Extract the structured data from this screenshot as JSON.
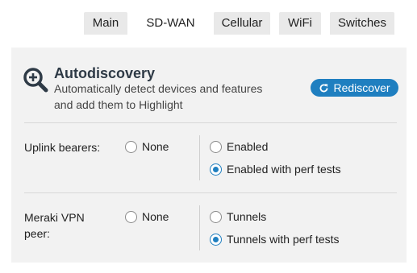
{
  "tabs": [
    {
      "label": "Main",
      "active": false
    },
    {
      "label": "SD-WAN",
      "active": true
    },
    {
      "label": "Cellular",
      "active": false
    },
    {
      "label": "WiFi",
      "active": false
    },
    {
      "label": "Switches",
      "active": false
    }
  ],
  "autodiscovery": {
    "icon": "magnifier-plus-icon",
    "title": "Autodiscovery",
    "description_line1": "Automatically detect devices and features",
    "description_line2": "and add them to Highlight",
    "button_label": "Rediscover",
    "button_icon": "refresh-icon",
    "accent_color": "#1f7fc0"
  },
  "uplink": {
    "label": "Uplink bearers:",
    "options": [
      {
        "label": "None",
        "checked": false
      },
      {
        "label": "Enabled",
        "checked": false
      },
      {
        "label": "Enabled with perf tests",
        "checked": true
      }
    ]
  },
  "vpn": {
    "label_line1": "Meraki VPN",
    "label_line2": "peer:",
    "options": [
      {
        "label": "None",
        "checked": false
      },
      {
        "label": "Tunnels",
        "checked": false
      },
      {
        "label": "Tunnels with perf tests",
        "checked": true
      }
    ]
  }
}
